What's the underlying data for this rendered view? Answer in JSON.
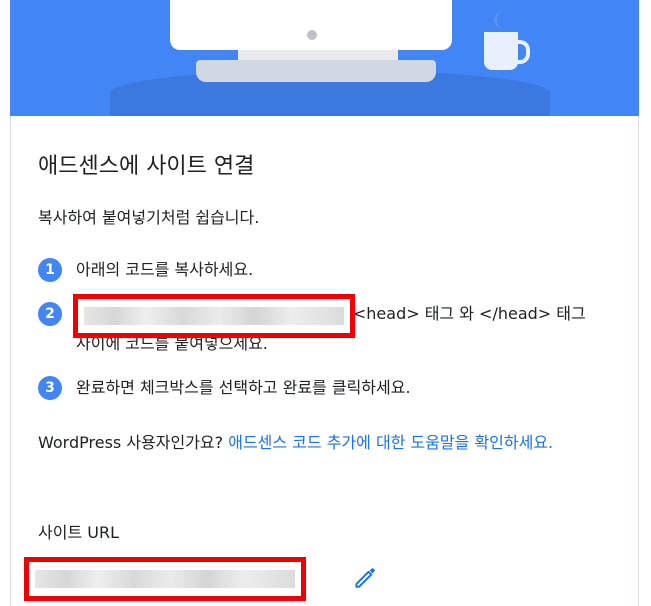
{
  "card": {
    "title": "애드센스에 사이트 연결",
    "subtitle": "복사하여 붙여넣기처럼 쉽습니다.",
    "steps": [
      {
        "number": "1",
        "text": "아래의 코드를 복사하세요."
      },
      {
        "number": "2",
        "text": "                                   의 HTML에서 <head> 태그 와 </head> 태그 사이에 코드를 붙여넣으세요."
      },
      {
        "number": "3",
        "text": "완료하면 체크박스를 선택하고 완료를 클릭하세요."
      }
    ],
    "wordpress_text": "WordPress 사용자인가요? ",
    "wordpress_link": "애드센스 코드 추가에 대한 도움말을 확인하세요.",
    "site_url_label": "사이트 URL"
  },
  "icons": {
    "edit": "pencil-icon"
  },
  "colors": {
    "hero": "#4285f4",
    "badge": "#4285f4",
    "link": "#1a73e8",
    "redaction": "#f00000"
  }
}
